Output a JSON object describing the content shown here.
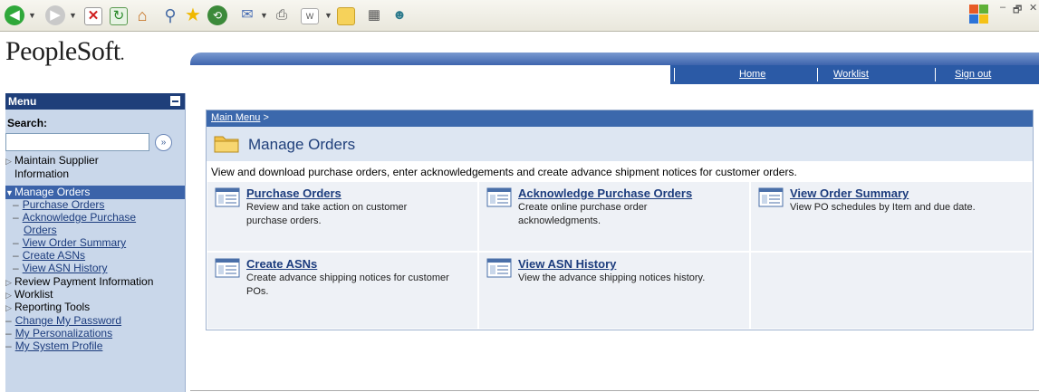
{
  "browser": {
    "toolbar_icons": [
      "back-icon",
      "forward-icon",
      "stop-icon",
      "refresh-icon",
      "home-icon",
      "search-icon",
      "favorites-icon",
      "history-icon",
      "mail-icon",
      "print-icon",
      "edit-word-icon",
      "discuss-icon",
      "research-icon",
      "messenger-icon"
    ],
    "window_controls": [
      "–",
      "🗗",
      "✕"
    ]
  },
  "header": {
    "logo_text": "PeopleSoft",
    "logo_dot": ".",
    "nav": {
      "home": "Home",
      "worklist": "Worklist",
      "sign_out": "Sign out"
    }
  },
  "menu": {
    "title": "Menu",
    "search_label": "Search:",
    "search_value": "",
    "search_go": "»",
    "items": [
      {
        "label_line1": "Maintain Supplier",
        "label_line2": "Information"
      },
      {
        "label": "Manage Orders"
      },
      {
        "label": "Review Payment Information"
      },
      {
        "label": "Worklist"
      },
      {
        "label": "Reporting Tools"
      }
    ],
    "sub_items": [
      "Purchase Orders",
      "Acknowledge Purchase",
      "Orders",
      "View Order Summary",
      "Create ASNs",
      "View ASN History"
    ],
    "links": [
      "Change My Password",
      "My Personalizations",
      "My System Profile"
    ]
  },
  "content": {
    "breadcrumb": "Main Menu",
    "breadcrumb_sep": ">",
    "title": "Manage Orders",
    "description": "View and download purchase orders, enter acknowledgements and create advance shipment notices for customer orders.",
    "tiles": [
      {
        "label": "Purchase Orders",
        "text1": "Review and take action on customer",
        "text2": "purchase orders."
      },
      {
        "label": "Acknowledge Purchase Orders",
        "text1": "Create online purchase order",
        "text2": "acknowledgments."
      },
      {
        "label": "View Order Summary",
        "text1": "View PO schedules by Item and due date.",
        "text2": ""
      },
      {
        "label": "Create ASNs",
        "text1": "Create advance shipping notices for customer",
        "text2": "POs."
      },
      {
        "label": "View ASN History",
        "text1": "View the advance shipping notices history.",
        "text2": ""
      }
    ]
  },
  "colors": {
    "header_blue": "#2b5aa6",
    "menu_head": "#1f3f7a",
    "menu_bg": "#c9d7ea",
    "selected": "#3b63a9",
    "link": "#1c3c7d",
    "tile_bg": "#eef1f6"
  }
}
